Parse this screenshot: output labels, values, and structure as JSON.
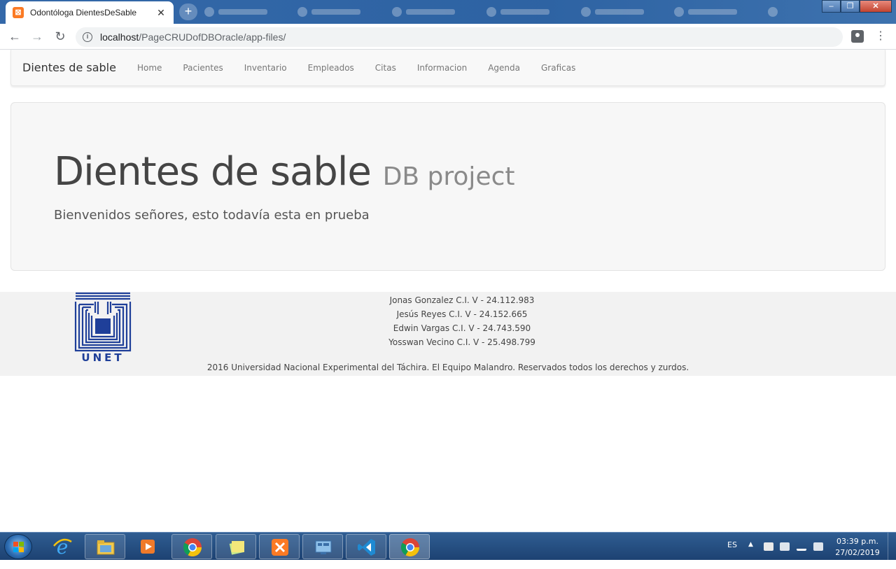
{
  "browser": {
    "tab_title": "Odontóloga DientesDeSable",
    "tab_close": "✕",
    "new_tab": "+",
    "url_host": "localhost",
    "url_path": "/PageCRUDofDBOracle/app-files/",
    "back": "←",
    "forward": "→",
    "reload": "↻",
    "info": "i",
    "menu": "⋮"
  },
  "navbar": {
    "brand": "Dientes de sable",
    "links": [
      "Home",
      "Pacientes",
      "Inventario",
      "Empleados",
      "Citas",
      "Informacion",
      "Agenda",
      "Graficas"
    ]
  },
  "jumbotron": {
    "title": "Dientes de sable",
    "subtitle": "DB project",
    "lead": "Bienvenidos señores, esto todavía esta en prueba"
  },
  "footer": {
    "logo_text": "UNET",
    "credits": [
      "Jonas Gonzalez C.I. V - 24.112.983",
      "Jesús Reyes C.I. V - 24.152.665",
      "Edwin Vargas C.I. V - 24.743.590",
      "Yosswan Vecino C.I. V - 25.498.799"
    ],
    "copyright": "2016 Universidad Nacional Experimental del Táchira. El Equipo Malandro. Reservados todos los derechos y zurdos."
  },
  "taskbar": {
    "language": "ES",
    "tray_arrow": "▲",
    "time": "03:39 p.m.",
    "date": "27/02/2019"
  },
  "colors": {
    "xampp_orange": "#fb7a24",
    "navbar_bg": "#f8f8f8",
    "jumbotron_bg": "#f7f7f7",
    "footer_bg": "#f2f2f2",
    "unet_blue": "#1f3f99",
    "taskbar": "#1d4272"
  }
}
